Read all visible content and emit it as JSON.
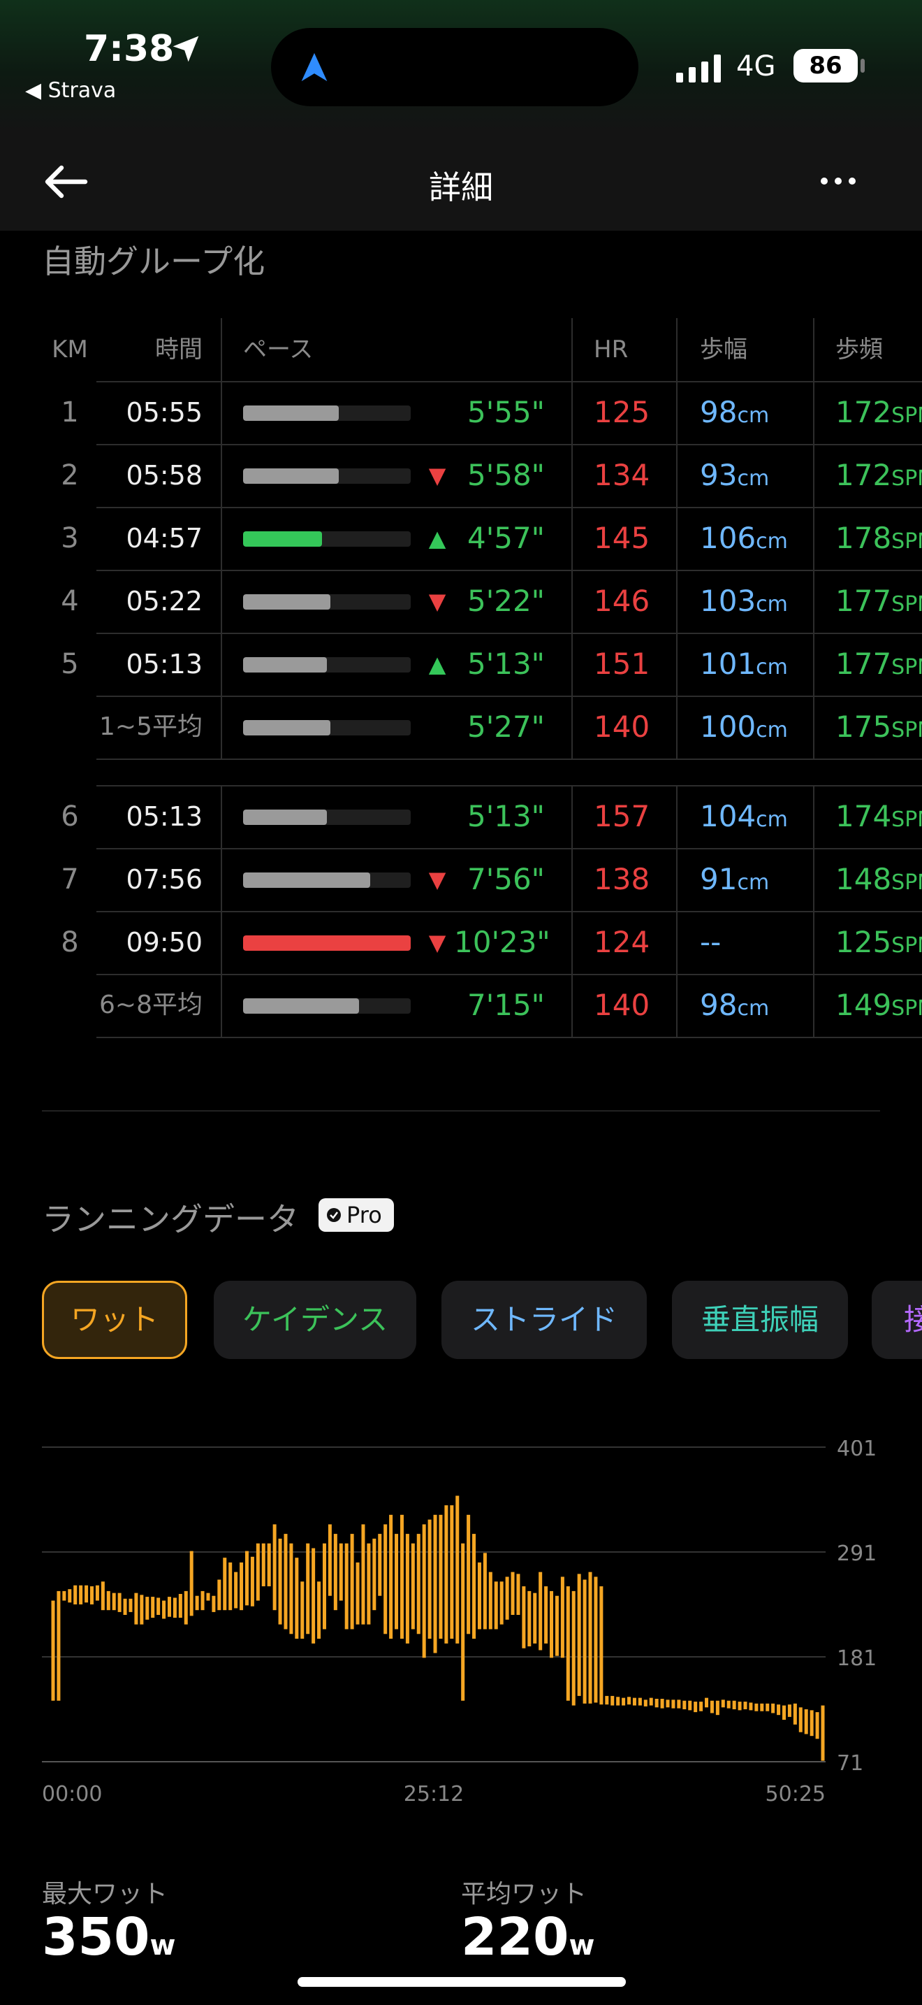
{
  "status_bar": {
    "time": "7:38",
    "back_app": "◀ Strava",
    "network": "4G",
    "battery": "86"
  },
  "nav": {
    "title": "詳細"
  },
  "splits": {
    "title": "自動グループ化",
    "headers": {
      "km": "KM",
      "time": "時間",
      "pace": "ペース",
      "hr": "HR",
      "stride": "歩幅",
      "cadence": "歩頻"
    },
    "stride_unit": "cm",
    "cadence_unit": "SPM",
    "rows": [
      {
        "km": "1",
        "time": "05:55",
        "bar_fraction": 0.57,
        "bar_color": "gray",
        "arrow": "",
        "pace": "5'55\"",
        "hr": "125",
        "stride": "98",
        "cadence": "172"
      },
      {
        "km": "2",
        "time": "05:58",
        "bar_fraction": 0.57,
        "bar_color": "gray",
        "arrow": "down",
        "pace": "5'58\"",
        "hr": "134",
        "stride": "93",
        "cadence": "172"
      },
      {
        "km": "3",
        "time": "04:57",
        "bar_fraction": 0.47,
        "bar_color": "green",
        "arrow": "up",
        "pace": "4'57\"",
        "hr": "145",
        "stride": "106",
        "cadence": "178"
      },
      {
        "km": "4",
        "time": "05:22",
        "bar_fraction": 0.52,
        "bar_color": "gray",
        "arrow": "down",
        "pace": "5'22\"",
        "hr": "146",
        "stride": "103",
        "cadence": "177"
      },
      {
        "km": "5",
        "time": "05:13",
        "bar_fraction": 0.5,
        "bar_color": "gray",
        "arrow": "up",
        "pace": "5'13\"",
        "hr": "151",
        "stride": "101",
        "cadence": "177"
      },
      {
        "km": "",
        "time": "1~5平均",
        "avg": true,
        "bar_fraction": 0.52,
        "bar_color": "gray",
        "arrow": "",
        "pace": "5'27\"",
        "hr": "140",
        "stride": "100",
        "cadence": "175"
      },
      {
        "km": "6",
        "time": "05:13",
        "bar_fraction": 0.5,
        "bar_color": "gray",
        "arrow": "",
        "pace": "5'13\"",
        "hr": "157",
        "stride": "104",
        "cadence": "174"
      },
      {
        "km": "7",
        "time": "07:56",
        "bar_fraction": 0.76,
        "bar_color": "gray",
        "arrow": "down",
        "pace": "7'56\"",
        "hr": "138",
        "stride": "91",
        "cadence": "148"
      },
      {
        "km": "8",
        "time": "09:50",
        "bar_fraction": 1.0,
        "bar_color": "red",
        "arrow": "down",
        "pace": "10'23\"",
        "hr": "124",
        "stride": "--",
        "cadence": "125"
      },
      {
        "km": "",
        "time": "6~8平均",
        "avg": true,
        "bar_fraction": 0.69,
        "bar_color": "gray",
        "arrow": "",
        "pace": "7'15\"",
        "hr": "140",
        "stride": "98",
        "cadence": "149"
      }
    ]
  },
  "running_data": {
    "title": "ランニングデータ",
    "badge": "Pro",
    "chips": [
      {
        "label": "ワット",
        "color": "#f5a623",
        "active": true
      },
      {
        "label": "ケイデンス",
        "color": "#3cc25a"
      },
      {
        "label": "ストライド",
        "color": "#6fb8ff"
      },
      {
        "label": "垂直振幅",
        "color": "#3ed0b8"
      },
      {
        "label": "接",
        "color": "#b469ff"
      }
    ],
    "stats": {
      "max_label": "最大ワット",
      "max_value": "350",
      "unit": "w",
      "avg_label": "平均ワット",
      "avg_value": "220"
    }
  },
  "chart_data": {
    "type": "bar",
    "series": [
      {
        "color": "#f5a623"
      }
    ],
    "ylim": [
      71,
      401
    ],
    "y_ticks": [
      401,
      291,
      181,
      71
    ],
    "x_tick_labels": [
      "00:00",
      "25:12",
      "50:25"
    ],
    "x_range_seconds": [
      0,
      3025
    ],
    "grid": true,
    "bars": [
      [
        0,
        135,
        240
      ],
      [
        1,
        135,
        250
      ],
      [
        2,
        240,
        250
      ],
      [
        3,
        238,
        252
      ],
      [
        4,
        236,
        256
      ],
      [
        5,
        236,
        256
      ],
      [
        6,
        238,
        256
      ],
      [
        7,
        236,
        255
      ],
      [
        8,
        240,
        256
      ],
      [
        9,
        230,
        260
      ],
      [
        10,
        230,
        250
      ],
      [
        11,
        230,
        248
      ],
      [
        12,
        228,
        248
      ],
      [
        13,
        225,
        242
      ],
      [
        14,
        228,
        242
      ],
      [
        15,
        215,
        248
      ],
      [
        16,
        215,
        246
      ],
      [
        17,
        220,
        244
      ],
      [
        18,
        222,
        244
      ],
      [
        19,
        225,
        243
      ],
      [
        20,
        221,
        240
      ],
      [
        21,
        223,
        244
      ],
      [
        22,
        222,
        243
      ],
      [
        23,
        222,
        247
      ],
      [
        24,
        215,
        250
      ],
      [
        25,
        224,
        292
      ],
      [
        26,
        230,
        245
      ],
      [
        27,
        230,
        250
      ],
      [
        28,
        240,
        248
      ],
      [
        29,
        228,
        245
      ],
      [
        30,
        230,
        262
      ],
      [
        31,
        230,
        285
      ],
      [
        32,
        230,
        280
      ],
      [
        33,
        232,
        270
      ],
      [
        34,
        230,
        280
      ],
      [
        35,
        235,
        292
      ],
      [
        36,
        234,
        286
      ],
      [
        37,
        240,
        300
      ],
      [
        38,
        255,
        300
      ],
      [
        39,
        255,
        300
      ],
      [
        40,
        230,
        320
      ],
      [
        41,
        215,
        305
      ],
      [
        42,
        210,
        310
      ],
      [
        43,
        205,
        300
      ],
      [
        44,
        200,
        285
      ],
      [
        45,
        200,
        260
      ],
      [
        46,
        205,
        300
      ],
      [
        47,
        195,
        295
      ],
      [
        48,
        200,
        260
      ],
      [
        49,
        210,
        300
      ],
      [
        50,
        245,
        320
      ],
      [
        51,
        230,
        310
      ],
      [
        52,
        240,
        300
      ],
      [
        53,
        210,
        300
      ],
      [
        54,
        210,
        310
      ],
      [
        55,
        215,
        280
      ],
      [
        56,
        215,
        320
      ],
      [
        57,
        215,
        300
      ],
      [
        58,
        230,
        305
      ],
      [
        59,
        245,
        310
      ],
      [
        60,
        205,
        320
      ],
      [
        61,
        200,
        330
      ],
      [
        62,
        210,
        310
      ],
      [
        63,
        200,
        330
      ],
      [
        64,
        195,
        310
      ],
      [
        65,
        210,
        300
      ],
      [
        66,
        205,
        310
      ],
      [
        67,
        180,
        320
      ],
      [
        68,
        200,
        325
      ],
      [
        69,
        185,
        330
      ],
      [
        70,
        200,
        330
      ],
      [
        71,
        195,
        340
      ],
      [
        72,
        200,
        340
      ],
      [
        73,
        195,
        350
      ],
      [
        74,
        135,
        300
      ],
      [
        75,
        205,
        330
      ],
      [
        76,
        200,
        310
      ],
      [
        77,
        210,
        280
      ],
      [
        78,
        210,
        290
      ],
      [
        79,
        210,
        270
      ],
      [
        80,
        210,
        260
      ],
      [
        81,
        215,
        260
      ],
      [
        82,
        220,
        265
      ],
      [
        83,
        225,
        270
      ],
      [
        84,
        225,
        268
      ],
      [
        85,
        190,
        255
      ],
      [
        86,
        192,
        250
      ],
      [
        87,
        195,
        248
      ],
      [
        88,
        188,
        270
      ],
      [
        89,
        195,
        255
      ],
      [
        90,
        180,
        250
      ],
      [
        91,
        182,
        245
      ],
      [
        92,
        180,
        265
      ],
      [
        93,
        135,
        255
      ],
      [
        94,
        130,
        250
      ],
      [
        95,
        140,
        268
      ],
      [
        96,
        132,
        262
      ],
      [
        97,
        132,
        270
      ],
      [
        98,
        133,
        265
      ],
      [
        99,
        131,
        255
      ],
      [
        100,
        131,
        140
      ],
      [
        101,
        130,
        140
      ],
      [
        102,
        130,
        139
      ],
      [
        103,
        130,
        138
      ],
      [
        104,
        131,
        139
      ],
      [
        105,
        130,
        138
      ],
      [
        106,
        130,
        138
      ],
      [
        107,
        129,
        136
      ],
      [
        108,
        130,
        138
      ],
      [
        109,
        128,
        137
      ],
      [
        110,
        127,
        137
      ],
      [
        111,
        128,
        136
      ],
      [
        112,
        127,
        136
      ],
      [
        113,
        127,
        136
      ],
      [
        114,
        126,
        135
      ],
      [
        115,
        125,
        135
      ],
      [
        116,
        123,
        134
      ],
      [
        117,
        124,
        134
      ],
      [
        118,
        128,
        138
      ],
      [
        119,
        122,
        135
      ],
      [
        120,
        120,
        135
      ],
      [
        121,
        128,
        136
      ],
      [
        122,
        127,
        135
      ],
      [
        123,
        126,
        135
      ],
      [
        124,
        125,
        134
      ],
      [
        125,
        126,
        134
      ],
      [
        126,
        125,
        133
      ],
      [
        127,
        124,
        132
      ],
      [
        128,
        124,
        132
      ],
      [
        129,
        124,
        132
      ],
      [
        130,
        122,
        132
      ],
      [
        131,
        120,
        131
      ],
      [
        132,
        115,
        130
      ],
      [
        133,
        118,
        131
      ],
      [
        134,
        110,
        132
      ],
      [
        135,
        102,
        128
      ],
      [
        136,
        100,
        126
      ],
      [
        137,
        98,
        125
      ],
      [
        138,
        95,
        123
      ],
      [
        139,
        72,
        130
      ]
    ]
  }
}
